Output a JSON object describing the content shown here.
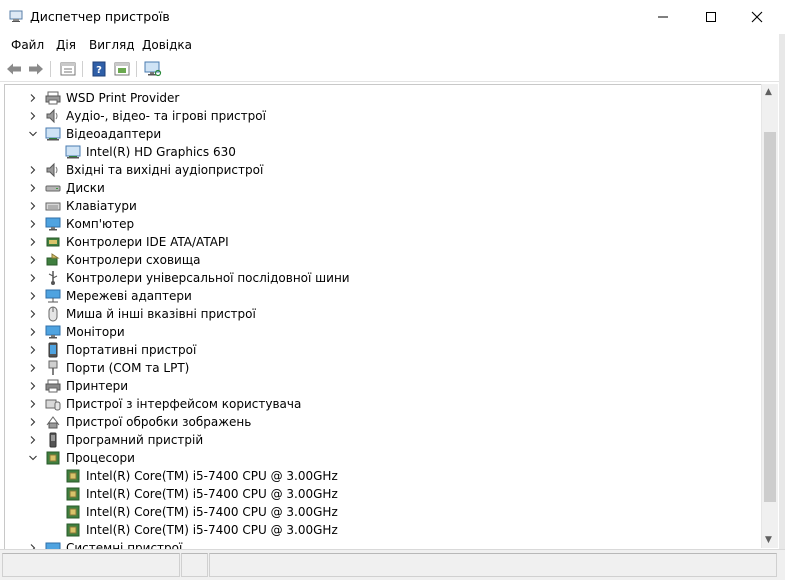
{
  "window": {
    "title": "Диспетчер пристроїв"
  },
  "menu": [
    "Файл",
    "Дія",
    "Вигляд",
    "Довідка"
  ],
  "toolbar": [
    "back-arrow-icon",
    "forward-arrow-icon",
    "properties-icon",
    "help-icon",
    "update-driver-icon",
    "scan-hardware-icon"
  ],
  "tree": [
    {
      "label": "WSD Print Provider",
      "icon": "wsd-printer-icon",
      "state": "collapsed",
      "level": 0
    },
    {
      "label": "Аудіо-, відео- та ігрові пристрої",
      "icon": "speaker-icon",
      "state": "collapsed",
      "level": 0
    },
    {
      "label": "Відеоадаптери",
      "icon": "display-adapter-icon",
      "state": "expanded",
      "level": 0
    },
    {
      "label": "Intel(R) HD Graphics 630",
      "icon": "display-adapter-icon",
      "state": "leaf",
      "level": 1
    },
    {
      "label": "Вхідні та вихідні аудіопристрої",
      "icon": "speaker-icon",
      "state": "collapsed",
      "level": 0
    },
    {
      "label": "Диски",
      "icon": "disk-drive-icon",
      "state": "collapsed",
      "level": 0
    },
    {
      "label": "Клавіатури",
      "icon": "keyboard-icon",
      "state": "collapsed",
      "level": 0
    },
    {
      "label": "Комп'ютер",
      "icon": "computer-icon",
      "state": "collapsed",
      "level": 0
    },
    {
      "label": "Контролери IDE ATA/ATAPI",
      "icon": "ide-controller-icon",
      "state": "collapsed",
      "level": 0
    },
    {
      "label": "Контролери сховища",
      "icon": "storage-controller-icon",
      "state": "collapsed",
      "level": 0
    },
    {
      "label": "Контролери універсальної послідовної шини",
      "icon": "usb-icon",
      "state": "collapsed",
      "level": 0
    },
    {
      "label": "Мережеві адаптери",
      "icon": "network-adapter-icon",
      "state": "collapsed",
      "level": 0
    },
    {
      "label": "Миша й інші вказівні пристрої",
      "icon": "mouse-icon",
      "state": "collapsed",
      "level": 0
    },
    {
      "label": "Монітори",
      "icon": "monitor-icon",
      "state": "collapsed",
      "level": 0
    },
    {
      "label": "Портативні пристрої",
      "icon": "portable-device-icon",
      "state": "collapsed",
      "level": 0
    },
    {
      "label": "Порти (COM та LPT)",
      "icon": "port-icon",
      "state": "collapsed",
      "level": 0
    },
    {
      "label": "Принтери",
      "icon": "printer-icon",
      "state": "collapsed",
      "level": 0
    },
    {
      "label": "Пристрої з інтерфейсом користувача",
      "icon": "hid-icon",
      "state": "collapsed",
      "level": 0
    },
    {
      "label": "Пристрої обробки зображень",
      "icon": "imaging-device-icon",
      "state": "collapsed",
      "level": 0
    },
    {
      "label": "Програмний пристрій",
      "icon": "software-device-icon",
      "state": "collapsed",
      "level": 0
    },
    {
      "label": "Процесори",
      "icon": "processor-icon",
      "state": "expanded",
      "level": 0
    },
    {
      "label": "Intel(R) Core(TM) i5-7400 CPU @ 3.00GHz",
      "icon": "processor-icon",
      "state": "leaf",
      "level": 1
    },
    {
      "label": "Intel(R) Core(TM) i5-7400 CPU @ 3.00GHz",
      "icon": "processor-icon",
      "state": "leaf",
      "level": 1
    },
    {
      "label": "Intel(R) Core(TM) i5-7400 CPU @ 3.00GHz",
      "icon": "processor-icon",
      "state": "leaf",
      "level": 1
    },
    {
      "label": "Intel(R) Core(TM) i5-7400 CPU @ 3.00GHz",
      "icon": "processor-icon",
      "state": "leaf",
      "level": 1
    },
    {
      "label": "Системні пристрої",
      "icon": "system-device-icon",
      "state": "collapsed",
      "level": 0
    }
  ],
  "colors": {
    "accent": "#1e73be",
    "chip": "#3f7f3f",
    "window_bg": "#ffffff",
    "chrome": "#f0f0f0"
  }
}
